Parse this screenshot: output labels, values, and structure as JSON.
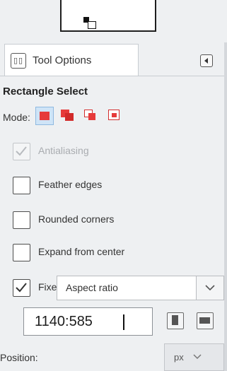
{
  "panel": {
    "tab_label": "Tool Options",
    "tab_icon": "tool-options-icon",
    "menu_icon": "tab-menu-triangle-icon"
  },
  "tool": {
    "title": "Rectangle Select",
    "mode_label": "Mode:",
    "modes": [
      {
        "name": "replace",
        "icon": "mode-replace-icon",
        "active": true
      },
      {
        "name": "add",
        "icon": "mode-add-icon",
        "active": false
      },
      {
        "name": "subtract",
        "icon": "mode-subtract-icon",
        "active": false
      },
      {
        "name": "intersect",
        "icon": "mode-intersect-icon",
        "active": false
      }
    ]
  },
  "options": {
    "antialiasing": {
      "label": "Antialiasing",
      "checked": true,
      "disabled": true
    },
    "feather_edges": {
      "label": "Feather edges",
      "checked": false
    },
    "rounded_corners": {
      "label": "Rounded corners",
      "checked": false
    },
    "expand_from_center": {
      "label": "Expand from center",
      "checked": false
    },
    "fixed": {
      "label": "Fixed:",
      "checked": true,
      "mode_value": "Aspect ratio",
      "ratio_value": "1140:585"
    }
  },
  "position": {
    "label": "Position:",
    "unit": "px"
  },
  "colors": {
    "accent": "#cfe4f7",
    "mode_red": "#e63a3a",
    "panel_bg": "#eef0f2"
  }
}
